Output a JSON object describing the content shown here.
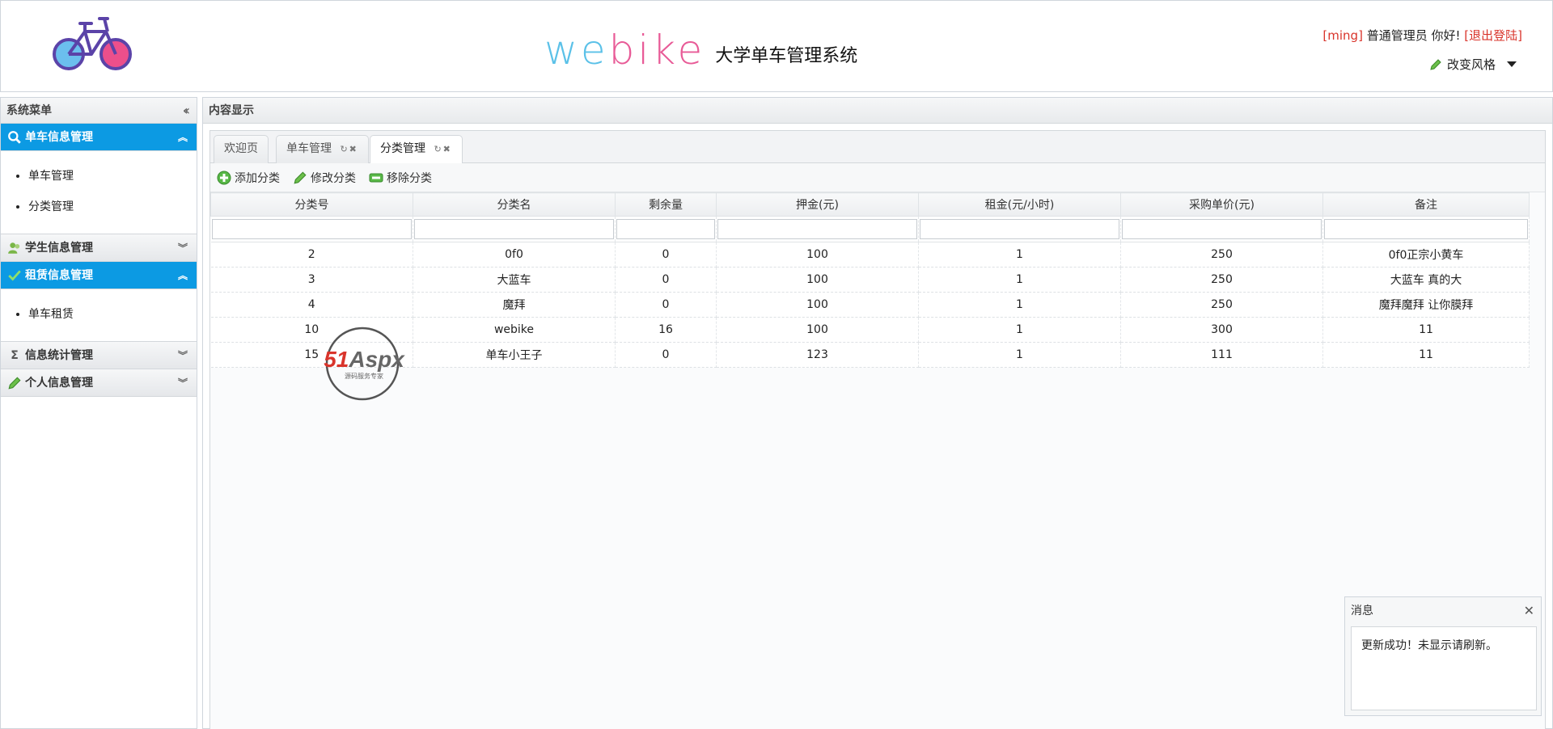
{
  "header": {
    "brand_we": "we",
    "brand_bike": "bike",
    "brand_subtitle": "大学单车管理系统",
    "user_name": "[ming]",
    "user_role": "普通管理员 你好!",
    "logout_label": "[退出登陆]",
    "style_label": "改变风格"
  },
  "sidebar": {
    "title": "系统菜单",
    "sections": [
      {
        "label": "单车信息管理",
        "icon": "search-icon",
        "items": [
          "单车管理",
          "分类管理"
        ]
      },
      {
        "label": "学生信息管理",
        "icon": "users-icon"
      },
      {
        "label": "租赁信息管理",
        "icon": "check-icon",
        "items": [
          "单车租赁"
        ]
      },
      {
        "label": "信息统计管理",
        "icon": "sigma-icon"
      },
      {
        "label": "个人信息管理",
        "icon": "pencil-icon"
      }
    ]
  },
  "content": {
    "title": "内容显示",
    "tabs": [
      "欢迎页",
      "单车管理",
      "分类管理"
    ],
    "toolbar": {
      "add": "添加分类",
      "edit": "修改分类",
      "remove": "移除分类"
    },
    "columns": [
      "分类号",
      "分类名",
      "剩余量",
      "押金(元)",
      "租金(元/小时)",
      "采购单价(元)",
      "备注"
    ],
    "rows": [
      [
        "2",
        "0f0",
        "0",
        "100",
        "1",
        "250",
        "0f0正宗小黄车"
      ],
      [
        "3",
        "大蓝车",
        "0",
        "100",
        "1",
        "250",
        "大蓝车 真的大"
      ],
      [
        "4",
        "魔拜",
        "0",
        "100",
        "1",
        "250",
        "魔拜魔拜 让你膜拜"
      ],
      [
        "10",
        "webike",
        "16",
        "100",
        "1",
        "300",
        "11"
      ],
      [
        "15",
        "单车小王子",
        "0",
        "123",
        "1",
        "111",
        "11"
      ]
    ]
  },
  "watermark": {
    "brand": "51Aspx",
    "tagline": "源码服务专家"
  },
  "message": {
    "title": "消息",
    "body": "更新成功！未显示请刷新。"
  },
  "colors": {
    "accent": "#0c9ae3",
    "brand_blue": "#5bc1e8",
    "brand_pink": "#e85b97",
    "logout_red": "#d9342b"
  }
}
